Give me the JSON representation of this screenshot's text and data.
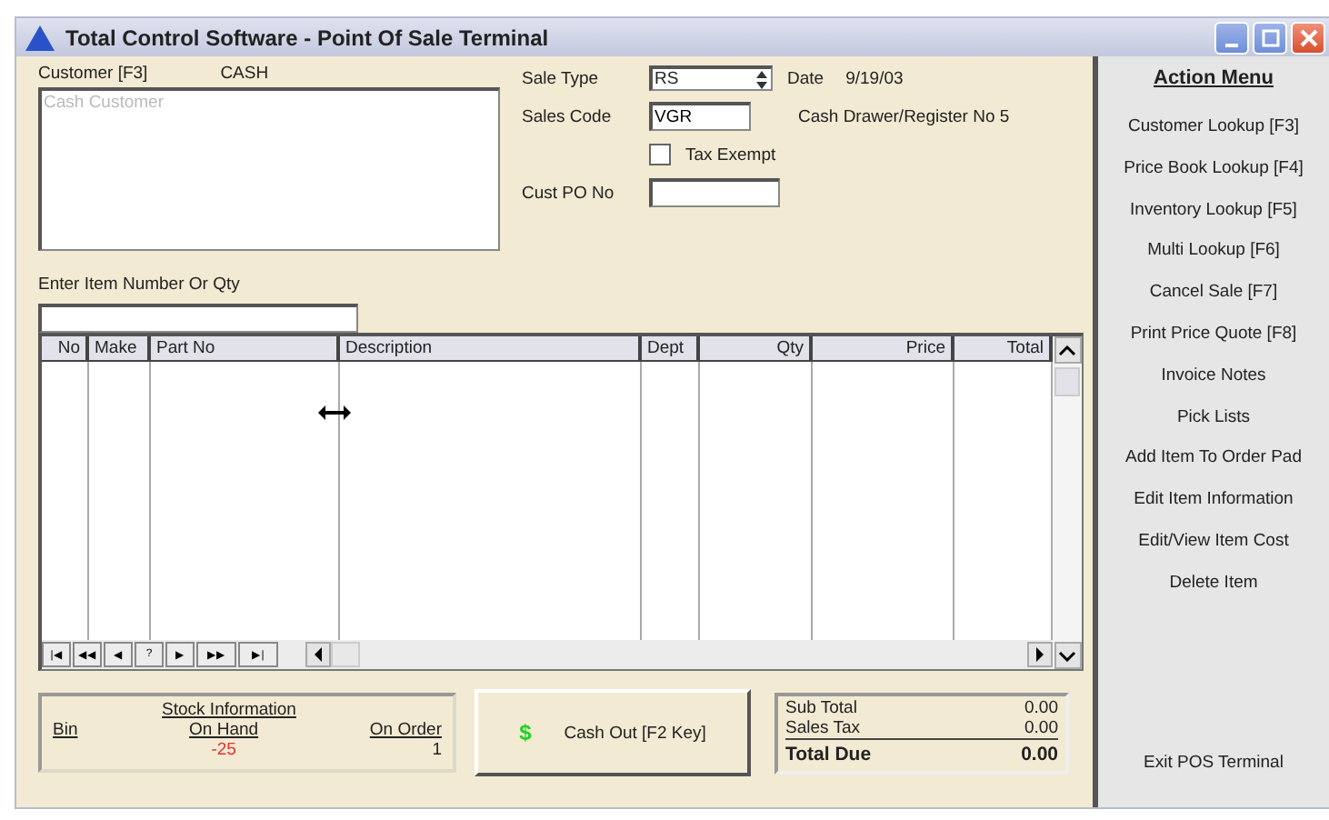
{
  "window": {
    "title": "Total Control Software - Point Of Sale Terminal"
  },
  "customer": {
    "label": "Customer [F3]",
    "value": "CASH",
    "placeholder": "Cash Customer"
  },
  "sale_type": {
    "label": "Sale Type",
    "value": "RS"
  },
  "date": {
    "label": "Date",
    "value": "9/19/03"
  },
  "sales_code": {
    "label": "Sales Code",
    "value": "VGR"
  },
  "register": "Cash Drawer/Register No 5",
  "tax_exempt": {
    "label": "Tax Exempt",
    "checked": false
  },
  "cust_po": {
    "label": "Cust PO No"
  },
  "item_entry": {
    "label": "Enter Item Number Or Qty"
  },
  "table": {
    "columns": [
      {
        "label": "No"
      },
      {
        "label": "Make"
      },
      {
        "label": "Part No"
      },
      {
        "label": "Description"
      },
      {
        "label": "Dept"
      },
      {
        "label": "Qty"
      },
      {
        "label": "Price"
      },
      {
        "label": "Total"
      }
    ],
    "nav": [
      "|◀",
      "◀◀",
      "◀",
      "?",
      "▶",
      "▶▶",
      "▶|"
    ]
  },
  "stock": {
    "title": "Stock Information",
    "bin_label": "Bin",
    "on_hand_label": "On Hand",
    "on_hand": "-25",
    "on_order_label": "On Order",
    "on_order": "1"
  },
  "cash_out": {
    "icon": "$",
    "label": "Cash Out [F2 Key]"
  },
  "totals": [
    {
      "label": "Sub Total",
      "value": "0.00",
      "kind": "normal"
    },
    {
      "label": "Sales Tax",
      "value": "0.00",
      "kind": "normal"
    },
    {
      "label": "Total Due",
      "value": "0.00",
      "kind": "grand"
    }
  ],
  "action_menu": {
    "title": "Action Menu",
    "items": [
      "Customer Lookup [F3]",
      "Price Book Lookup [F4]",
      "Inventory Lookup [F5]",
      "Multi Lookup [F6]",
      "Cancel Sale [F7]",
      "Print Price Quote [F8]",
      "Invoice Notes",
      "Pick Lists",
      "Add Item To Order Pad",
      "Edit Item Information",
      "Edit/View Item Cost",
      "Delete Item"
    ],
    "exit": "Exit POS Terminal"
  }
}
